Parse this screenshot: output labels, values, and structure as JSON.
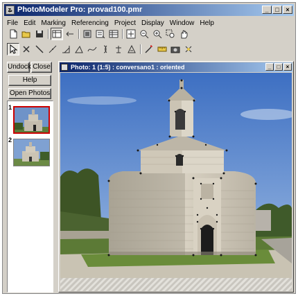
{
  "app": {
    "title": "PhotoModeler Pro: provad100.pmr",
    "icon": "photomodeler-app-icon"
  },
  "window_controls": {
    "minimize": "_",
    "maximize": "□",
    "close": "×"
  },
  "menu": [
    "File",
    "Edit",
    "Marking",
    "Referencing",
    "Project",
    "Display",
    "Window",
    "Help"
  ],
  "toolbar1_icons": [
    "new-file-icon",
    "open-folder-icon",
    "save-icon",
    "sep",
    "photo-table-icon",
    "arrows-icon",
    "sep",
    "photo-view-icon",
    "2d-view-icon",
    "table-view-icon",
    "sep",
    "zoom-fit-icon",
    "zoom-out-icon",
    "zoom-in-icon",
    "zoom-box-icon",
    "pan-hand-icon"
  ],
  "toolbar2_icons": [
    "select-arrow-icon",
    "point-mark-icon",
    "line-icon",
    "curve-icon",
    "edge-icon",
    "surface-icon",
    "spline-icon",
    "cylinder-icon",
    "constraint-icon",
    "triangle-icon",
    "sep",
    "wand-icon",
    "measure-icon",
    "camera-icon",
    "auto-icon"
  ],
  "sidebar": {
    "undock": "Undock",
    "close": "Close",
    "help": "Help",
    "open_photos": "Open Photos"
  },
  "thumbnails": [
    {
      "num": "1",
      "selected": true
    },
    {
      "num": "2",
      "selected": false
    }
  ],
  "photo_window": {
    "title": "Photo: 1 (1:5) : conversano1 : oriented"
  },
  "colors": {
    "titlebar": "#0a246a",
    "face": "#d4d0c8",
    "selected_thumb": "#cc0000",
    "marker": "#1a1a1a"
  }
}
